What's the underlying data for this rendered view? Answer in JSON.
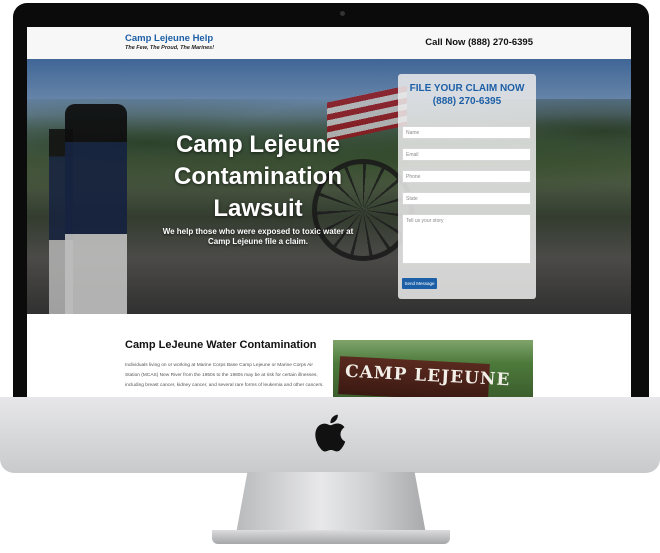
{
  "header": {
    "brand_name": "Camp Lejeune Help",
    "tagline": "The Few, The Proud, The Marines!",
    "call_now": "Call Now (888) 270-6395"
  },
  "hero": {
    "title": "Camp Lejeune Contamination Lawsuit",
    "subtitle": "We help those who were exposed to toxic water at Camp Lejeune file a claim."
  },
  "claim_form": {
    "heading_line1": "FILE YOUR CLAIM NOW",
    "heading_line2": "(888) 270-6395",
    "name_placeholder": "Name",
    "email_placeholder": "Email",
    "phone_placeholder": "Phone",
    "state_placeholder": "State",
    "story_placeholder": "Tell us your story",
    "submit_label": "Send Message"
  },
  "content": {
    "section_title": "Camp LeJeune Water Contamination",
    "section_body": "Individuals living on or working at Marine Corps Base Camp Lejeune or Marine Corps Air Station (MCAS) New River from the 1950s to the 1980s may be at risk for certain illnesses, including breast cancer, kidney cancer, and several rare forms of leukemia and other cancers.",
    "sign_text": "CAMP LEJEUNE"
  },
  "colors": {
    "brand_blue": "#1d5fa6",
    "header_bg": "#f7f7f7"
  },
  "icons": {
    "device_logo": "apple-logo-icon"
  }
}
